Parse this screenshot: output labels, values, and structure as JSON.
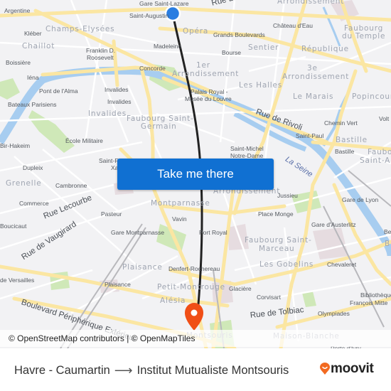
{
  "map": {
    "button_label": "Take me there",
    "attribution": "© OpenStreetMap contributors | © OpenMapTiles",
    "origin_marker": {
      "color": "#2a7de1"
    },
    "destination_marker": {
      "color": "#f04e16"
    },
    "route_color": "#222222",
    "poi_labels": [
      "Argentine",
      "Gare Saint-Lazare",
      "Saint-Augustin",
      "Kléber",
      "Franklin D.",
      "Roosevelt",
      "Boissière",
      "Madeleine",
      "Concorde",
      "Iéna",
      "Pont de l'Alma",
      "Invalides",
      "Invalides",
      "Bateaux Parisiens",
      "Château d'Eau",
      "Grands Boulevards",
      "Bourse",
      "Palais Royal -",
      "Musée du Louvre",
      "Chemin Vert",
      "Saint-Paul",
      "Bastille",
      "Saint-Michel",
      "Notre-Dame",
      "Volt",
      "École Militaire",
      "Bir-Hakeim",
      "Dupleix",
      "Saint-F",
      "Xa",
      "Cambronne",
      "Commerce",
      "Pasteur",
      "Boucicaut",
      "Vavin",
      "Gare Montparnasse",
      "Port Royal",
      "Jussieu",
      "Place Monge",
      "Gare de Lyon",
      "Gare d'Austerlitz",
      "Be",
      "Chevaleret",
      "Denfert-Rochereau",
      "Glacière",
      "Corvisart",
      "Olympiades",
      "Bibliothèque",
      "François Mitte",
      "de Versailles",
      "Plaisance",
      "Porte d'Ivry"
    ],
    "district_labels": [
      "Champs-Elysées",
      "Chaillot",
      "Opéra",
      "1er",
      "Arrondissement",
      "Sentier",
      "République",
      "Faubourg",
      "du Temple",
      "3e",
      "Arrondissement",
      "Les Halles",
      "Le Marais",
      "Popincourt",
      "Invalides",
      "Faubourg Saint-",
      "Germain",
      "Bastille",
      "Faubourg",
      "Saint-Antoine",
      "Arrondissement",
      "Grenelle",
      "Montparnasse",
      "Faubourg Saint-",
      "Marceau",
      "Les Gobelins",
      "Plaisance",
      "Petit-Montrouge",
      "Alésia",
      "Maison-Blanche",
      "Montsouris",
      "Arrondissement",
      "B"
    ],
    "street_labels": [
      "Rue La Fayette",
      "Rue de Rivoli",
      "Rue Lecourbe",
      "Rue de Vaugirard",
      "Boulevard Périphérique Extérieur",
      "Rue de Tolbiac"
    ],
    "river_label": "La Seine"
  },
  "footer": {
    "origin": "Havre - Caumartin",
    "arrow": "⟶",
    "destination": "Institut Mutualiste Montsouris",
    "brand": "moovit",
    "brand_color": "#f26a21"
  }
}
